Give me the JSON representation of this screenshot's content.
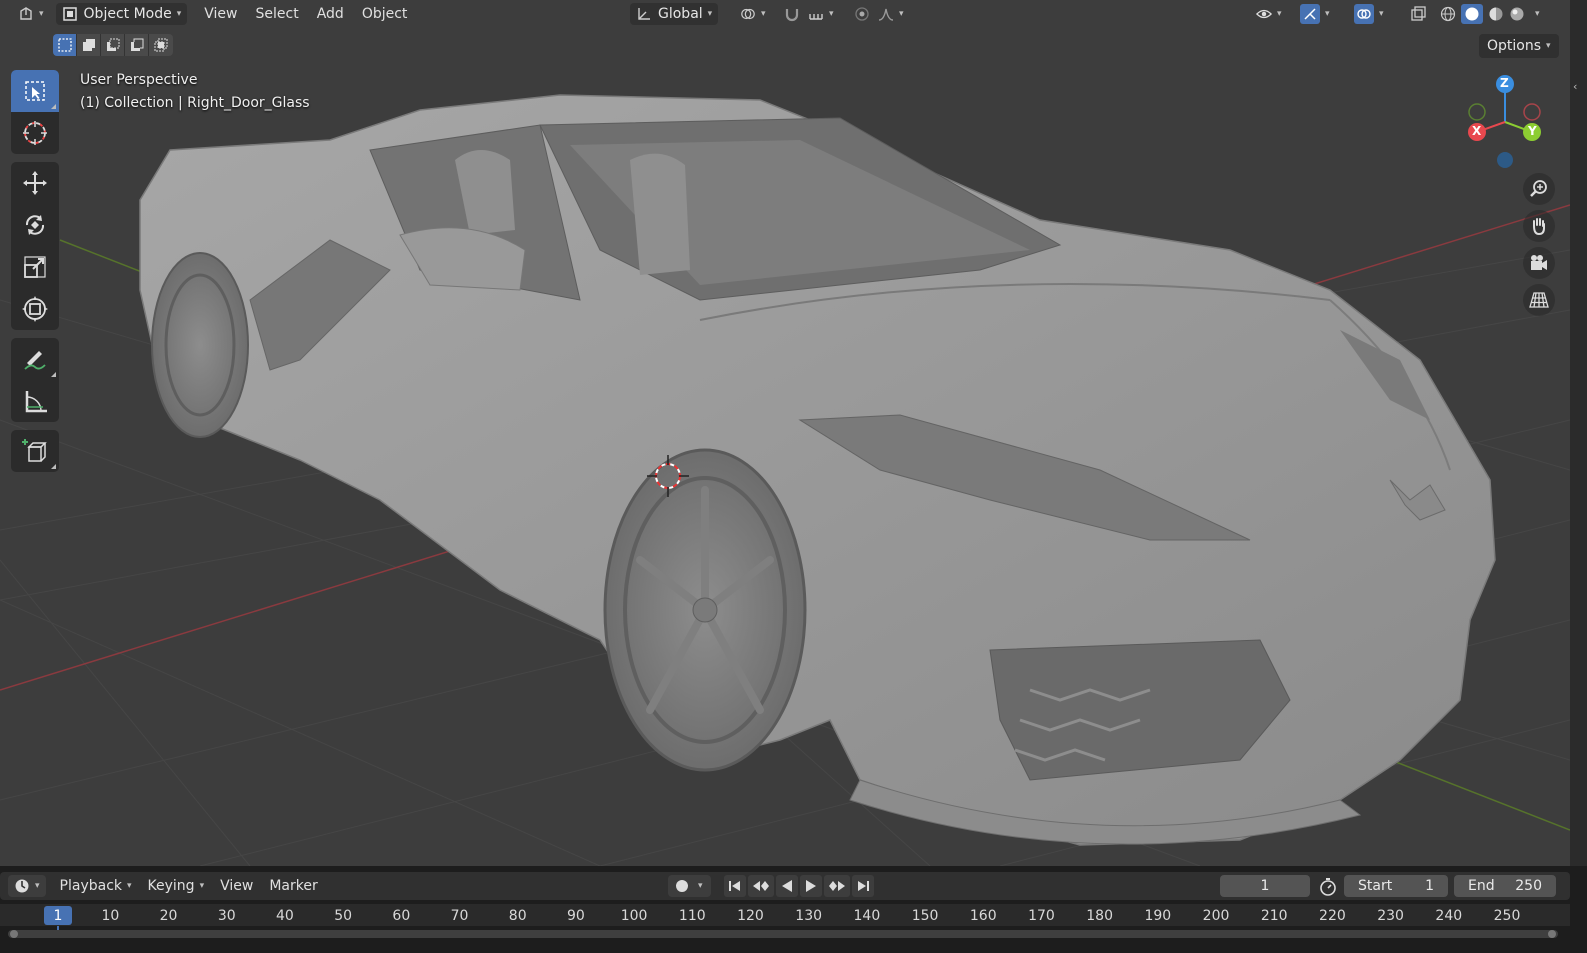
{
  "header": {
    "editor_type_icon": "viewport-icon",
    "mode_label": "Object Mode",
    "menus": [
      "View",
      "Select",
      "Add",
      "Object"
    ],
    "transform_orientation": "Global",
    "options_label": "Options"
  },
  "viewport_info": {
    "perspective": "User Perspective",
    "collection": "(1) Collection | Right_Door_Glass"
  },
  "gizmo": {
    "x": "X",
    "y": "Y",
    "z": "Z"
  },
  "toolbar": {
    "tools": [
      "select-box",
      "cursor",
      "move",
      "rotate",
      "scale",
      "transform",
      "annotate",
      "measure",
      "add-cube"
    ],
    "active": "select-box"
  },
  "timeline": {
    "menus": [
      "Playback",
      "Keying",
      "View",
      "Marker"
    ],
    "current_frame": "1",
    "start_label": "Start",
    "start_value": "1",
    "end_label": "End",
    "end_value": "250",
    "ruler_labels": [
      "10",
      "20",
      "30",
      "40",
      "50",
      "60",
      "70",
      "80",
      "90",
      "100",
      "110",
      "120",
      "130",
      "140",
      "150",
      "160",
      "170",
      "180",
      "190",
      "200",
      "210",
      "220",
      "230",
      "240",
      "250"
    ],
    "frame_indicator": "1"
  },
  "colors": {
    "accent": "#4772b3",
    "viewport_bg": "#3c3c3c",
    "axis_x": "#e8484e",
    "axis_y": "#8ccd32",
    "axis_z": "#3a8ee0"
  }
}
